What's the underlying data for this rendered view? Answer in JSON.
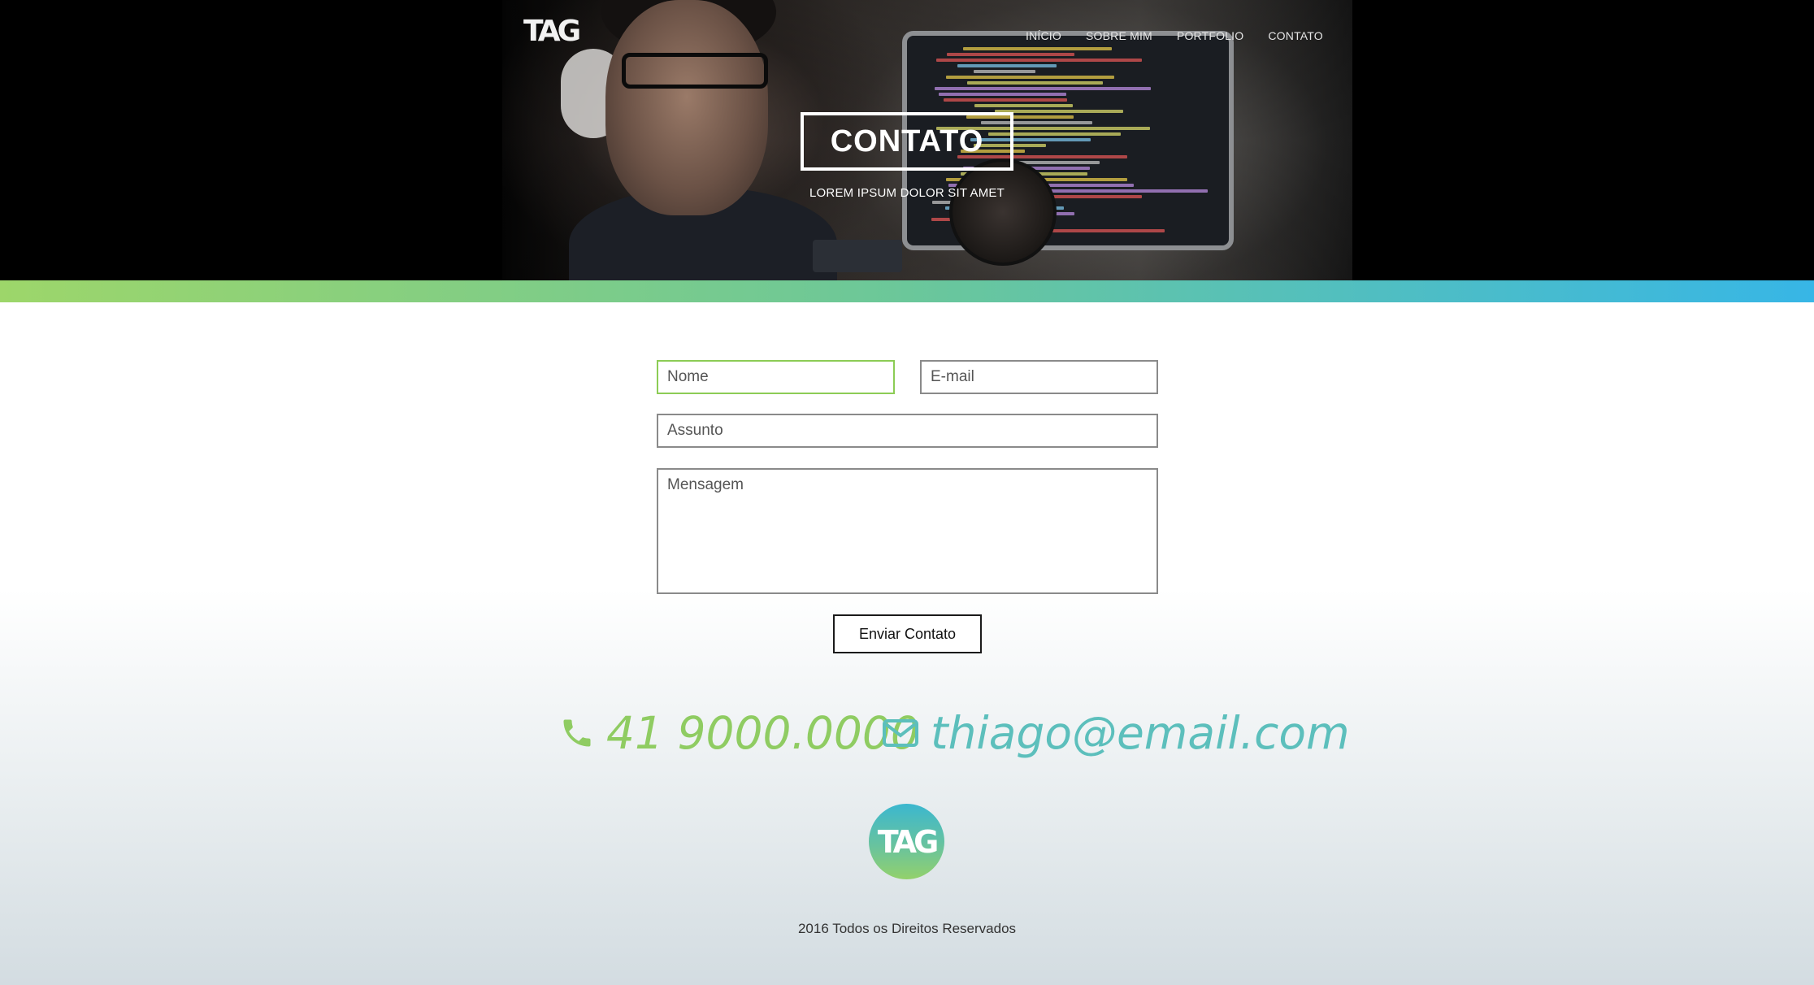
{
  "brand": {
    "logo_text": "TAG"
  },
  "nav": {
    "items": [
      {
        "label": "INÍCIO"
      },
      {
        "label": "SOBRE MIM"
      },
      {
        "label": "PORTFOLIO"
      },
      {
        "label": "CONTATO"
      }
    ]
  },
  "hero": {
    "title": "CONTATO",
    "subtitle": "LOREM IPSUM DOLOR SIT AMET"
  },
  "form": {
    "name_placeholder": "Nome",
    "email_placeholder": "E-mail",
    "subject_placeholder": "Assunto",
    "message_placeholder": "Mensagem",
    "submit_label": "Enviar Contato"
  },
  "contact": {
    "phone": "41 9000.0000",
    "email": "thiago@email.com"
  },
  "footer": {
    "logo_text": "TAG",
    "copyright": "2016 Todos os Direitos Reservados"
  },
  "colors": {
    "green": "#8fcc62",
    "teal": "#5cbfbc",
    "blue": "#37b6e6"
  },
  "icons": {
    "phone": "phone-icon",
    "mail": "envelope-icon"
  }
}
